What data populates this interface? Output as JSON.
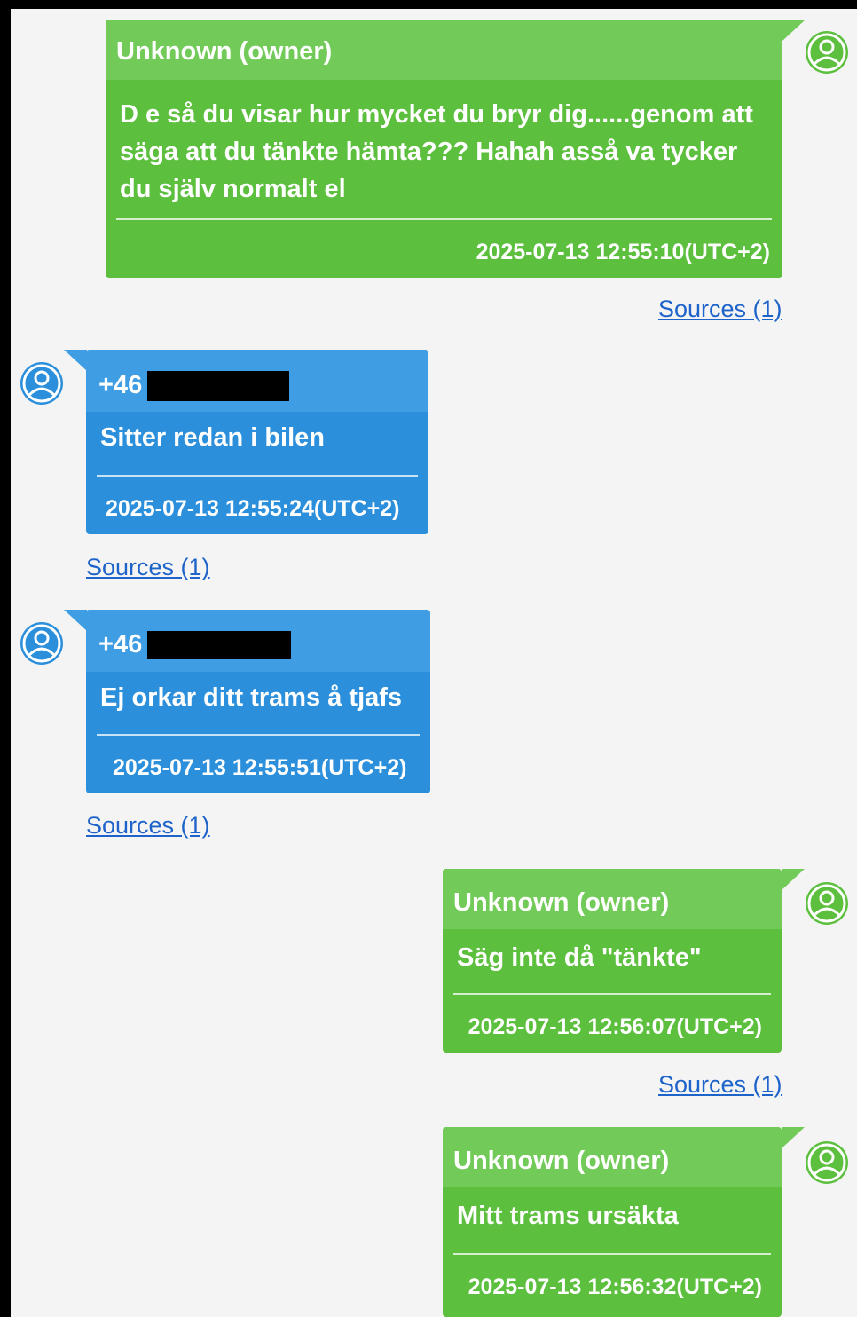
{
  "colors": {
    "owner_bubble": "#5cbf3e",
    "owner_header": "#72cb58",
    "contact_bubble": "#2b8fdb",
    "contact_header": "#3f9ee3",
    "link": "#1e63c9",
    "background": "#f4f4f4"
  },
  "messages": [
    {
      "direction": "outgoing",
      "sender": "Unknown (owner)",
      "text_lines": [
        "D e så du visar hur mycket du bryr dig......genom att",
        "säga att du tänkte hämta??? Hahah asså va tycker",
        "du själv normalt el"
      ],
      "timestamp": "2025-07-13 12:55:10(UTC+2)",
      "sources": "Sources (1)",
      "avatar_icon": "user-avatar-icon"
    },
    {
      "direction": "incoming",
      "sender": "+46",
      "sender_redacted": true,
      "text_lines": [
        "Sitter redan i bilen"
      ],
      "timestamp": "2025-07-13 12:55:24(UTC+2)",
      "sources": "Sources (1)",
      "avatar_icon": "user-avatar-icon"
    },
    {
      "direction": "incoming",
      "sender": "+46",
      "sender_redacted": true,
      "text_lines": [
        "Ej orkar ditt trams å tjafs"
      ],
      "timestamp": "2025-07-13 12:55:51(UTC+2)",
      "sources": "Sources (1)",
      "avatar_icon": "user-avatar-icon"
    },
    {
      "direction": "outgoing",
      "sender": "Unknown (owner)",
      "text_lines": [
        "Säg inte då \"tänkte\""
      ],
      "timestamp": "2025-07-13 12:56:07(UTC+2)",
      "sources": "Sources (1)",
      "avatar_icon": "user-avatar-icon"
    },
    {
      "direction": "outgoing",
      "sender": "Unknown (owner)",
      "text_lines": [
        "Mitt trams ursäkta"
      ],
      "timestamp": "2025-07-13 12:56:32(UTC+2)",
      "sources": "",
      "avatar_icon": "user-avatar-icon"
    }
  ]
}
